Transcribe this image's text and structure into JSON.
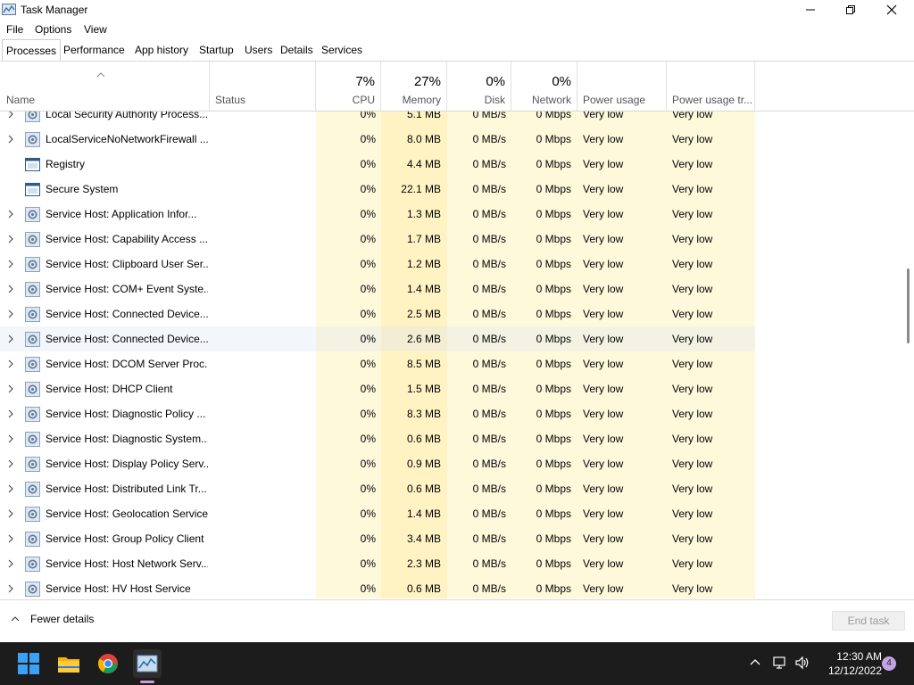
{
  "window": {
    "title": "Task Manager",
    "menu": [
      "File",
      "Options",
      "View"
    ],
    "tabs": [
      "Processes",
      "Performance",
      "App history",
      "Startup",
      "Users",
      "Details",
      "Services"
    ],
    "active_tab": "Processes"
  },
  "columns": {
    "name": "Name",
    "status": "Status",
    "cpu": {
      "pct": "7%",
      "label": "CPU"
    },
    "memory": {
      "pct": "27%",
      "label": "Memory"
    },
    "disk": {
      "pct": "0%",
      "label": "Disk"
    },
    "network": {
      "pct": "0%",
      "label": "Network"
    },
    "power": "Power usage",
    "power_trend": "Power usage tr..."
  },
  "rows": [
    {
      "name": "Local Security Authority Process...",
      "expand": true,
      "icon": "gear",
      "cpu": "0%",
      "mem": "5.1 MB",
      "disk": "0 MB/s",
      "net": "0 Mbps",
      "power": "Very low",
      "trend": "Very low"
    },
    {
      "name": "LocalServiceNoNetworkFirewall ...",
      "expand": true,
      "icon": "gear",
      "cpu": "0%",
      "mem": "8.0 MB",
      "disk": "0 MB/s",
      "net": "0 Mbps",
      "power": "Very low",
      "trend": "Very low"
    },
    {
      "name": "Registry",
      "expand": false,
      "icon": "window",
      "cpu": "0%",
      "mem": "4.4 MB",
      "disk": "0 MB/s",
      "net": "0 Mbps",
      "power": "Very low",
      "trend": "Very low"
    },
    {
      "name": "Secure System",
      "expand": false,
      "icon": "window",
      "cpu": "0%",
      "mem": "22.1 MB",
      "disk": "0 MB/s",
      "net": "0 Mbps",
      "power": "Very low",
      "trend": "Very low"
    },
    {
      "name": "Service Host: Application Infor...",
      "expand": true,
      "icon": "gear",
      "cpu": "0%",
      "mem": "1.3 MB",
      "disk": "0 MB/s",
      "net": "0 Mbps",
      "power": "Very low",
      "trend": "Very low"
    },
    {
      "name": "Service Host: Capability Access ...",
      "expand": true,
      "icon": "gear",
      "cpu": "0%",
      "mem": "1.7 MB",
      "disk": "0 MB/s",
      "net": "0 Mbps",
      "power": "Very low",
      "trend": "Very low"
    },
    {
      "name": "Service Host: Clipboard User Ser...",
      "expand": true,
      "icon": "gear",
      "cpu": "0%",
      "mem": "1.2 MB",
      "disk": "0 MB/s",
      "net": "0 Mbps",
      "power": "Very low",
      "trend": "Very low"
    },
    {
      "name": "Service Host: COM+ Event Syste...",
      "expand": true,
      "icon": "gear",
      "cpu": "0%",
      "mem": "1.4 MB",
      "disk": "0 MB/s",
      "net": "0 Mbps",
      "power": "Very low",
      "trend": "Very low"
    },
    {
      "name": "Service Host: Connected Device...",
      "expand": true,
      "icon": "gear",
      "cpu": "0%",
      "mem": "2.5 MB",
      "disk": "0 MB/s",
      "net": "0 Mbps",
      "power": "Very low",
      "trend": "Very low"
    },
    {
      "name": "Service Host: Connected Device...",
      "expand": true,
      "icon": "gear",
      "cpu": "0%",
      "mem": "2.6 MB",
      "disk": "0 MB/s",
      "net": "0 Mbps",
      "power": "Very low",
      "trend": "Very low",
      "selected": true
    },
    {
      "name": "Service Host: DCOM Server Proc...",
      "expand": true,
      "icon": "gear",
      "cpu": "0%",
      "mem": "8.5 MB",
      "disk": "0 MB/s",
      "net": "0 Mbps",
      "power": "Very low",
      "trend": "Very low"
    },
    {
      "name": "Service Host: DHCP Client",
      "expand": true,
      "icon": "gear",
      "cpu": "0%",
      "mem": "1.5 MB",
      "disk": "0 MB/s",
      "net": "0 Mbps",
      "power": "Very low",
      "trend": "Very low"
    },
    {
      "name": "Service Host: Diagnostic Policy ...",
      "expand": true,
      "icon": "gear",
      "cpu": "0%",
      "mem": "8.3 MB",
      "disk": "0 MB/s",
      "net": "0 Mbps",
      "power": "Very low",
      "trend": "Very low"
    },
    {
      "name": "Service Host: Diagnostic System...",
      "expand": true,
      "icon": "gear",
      "cpu": "0%",
      "mem": "0.6 MB",
      "disk": "0 MB/s",
      "net": "0 Mbps",
      "power": "Very low",
      "trend": "Very low"
    },
    {
      "name": "Service Host: Display Policy Serv...",
      "expand": true,
      "icon": "gear",
      "cpu": "0%",
      "mem": "0.9 MB",
      "disk": "0 MB/s",
      "net": "0 Mbps",
      "power": "Very low",
      "trend": "Very low"
    },
    {
      "name": "Service Host: Distributed Link Tr...",
      "expand": true,
      "icon": "gear",
      "cpu": "0%",
      "mem": "0.6 MB",
      "disk": "0 MB/s",
      "net": "0 Mbps",
      "power": "Very low",
      "trend": "Very low"
    },
    {
      "name": "Service Host: Geolocation Service",
      "expand": true,
      "icon": "gear",
      "cpu": "0%",
      "mem": "1.4 MB",
      "disk": "0 MB/s",
      "net": "0 Mbps",
      "power": "Very low",
      "trend": "Very low"
    },
    {
      "name": "Service Host: Group Policy Client",
      "expand": true,
      "icon": "gear",
      "cpu": "0%",
      "mem": "3.4 MB",
      "disk": "0 MB/s",
      "net": "0 Mbps",
      "power": "Very low",
      "trend": "Very low"
    },
    {
      "name": "Service Host: Host Network Serv...",
      "expand": true,
      "icon": "gear",
      "cpu": "0%",
      "mem": "2.3 MB",
      "disk": "0 MB/s",
      "net": "0 Mbps",
      "power": "Very low",
      "trend": "Very low"
    },
    {
      "name": "Service Host: HV Host Service",
      "expand": true,
      "icon": "gear",
      "cpu": "0%",
      "mem": "0.6 MB",
      "disk": "0 MB/s",
      "net": "0 Mbps",
      "power": "Very low",
      "trend": "Very low"
    }
  ],
  "footer": {
    "fewer_details": "Fewer details",
    "end_task": "End task"
  },
  "taskbar": {
    "time": "12:30 AM",
    "date": "12/12/2022",
    "notification_count": "4",
    "apps": [
      "windows-start-icon",
      "file-explorer-icon",
      "chrome-icon",
      "task-manager-icon"
    ]
  },
  "colors": {
    "heat_light": "#fff9dc",
    "heat_medium": "#fff3c4",
    "taskbar_bg": "#1c1c1c",
    "badge": "#c5a3e3"
  }
}
